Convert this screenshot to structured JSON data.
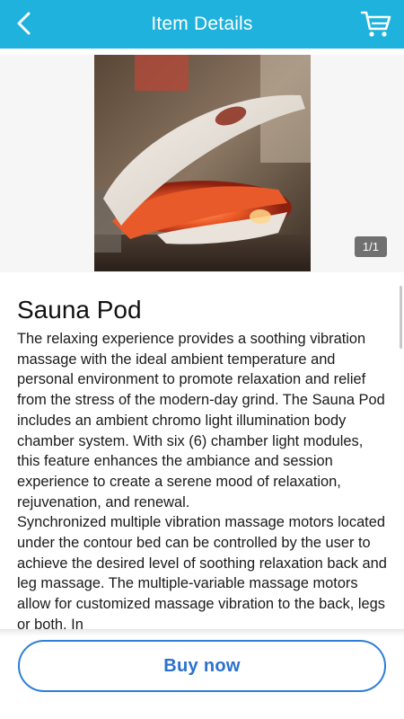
{
  "header": {
    "title": "Item Details",
    "back_icon": "chevron-left-icon",
    "cart_icon": "shopping-cart-icon",
    "background_color": "#1fb2dd"
  },
  "gallery": {
    "page_indicator": "1/1"
  },
  "product": {
    "title": "Sauna Pod",
    "description": [
      "The relaxing experience provides a soothing vibration massage with the ideal ambient temperature and personal environment to promote relaxation and relief from the stress of the modern-day grind. The Sauna Pod includes an ambient chromo light illumination body chamber system. With six (6) chamber light modules, this feature enhances the ambiance and session experience to create a serene mood of relaxation, rejuvenation, and renewal.",
      "Synchronized multiple vibration massage motors located under the contour bed can be controlled by the user to achieve the desired level of soothing relaxation back and leg massage. The multiple-variable massage motors allow for customized massage vibration to the back, legs or both. In"
    ]
  },
  "actions": {
    "buy_label": "Buy now",
    "accent_color": "#2e7ed8"
  }
}
